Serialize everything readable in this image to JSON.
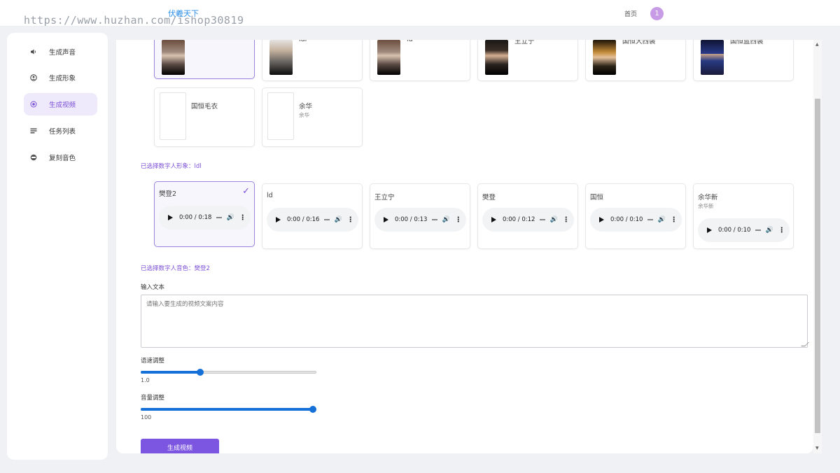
{
  "header": {
    "watermark": "https://www.huzhan.com/ishop30819",
    "brand": "伏羲天下",
    "home_link": "首页",
    "avatar_initial": "1"
  },
  "sidebar": {
    "items": [
      {
        "label": "生成声音",
        "icon": "speaker-icon",
        "active": false
      },
      {
        "label": "生成形象",
        "icon": "user-icon",
        "active": false
      },
      {
        "label": "生成视频",
        "icon": "target-icon",
        "active": true
      },
      {
        "label": "任务列表",
        "icon": "list-icon",
        "active": false
      },
      {
        "label": "复刻音色",
        "icon": "palette-icon",
        "active": false
      }
    ]
  },
  "avatars": {
    "row1": [
      {
        "name": "",
        "sub": "",
        "photo": "photo-a",
        "selected": true
      },
      {
        "name": "ldl",
        "sub": "",
        "photo": "photo-b",
        "selected": false
      },
      {
        "name": "ld",
        "sub": "",
        "photo": "photo-a",
        "selected": false
      },
      {
        "name": "王立宁",
        "sub": "",
        "photo": "photo-c",
        "selected": false
      },
      {
        "name": "国恒大西装",
        "sub": "",
        "photo": "photo-d",
        "selected": false
      },
      {
        "name": "国恒蓝西装",
        "sub": "",
        "photo": "photo-e",
        "selected": false
      }
    ],
    "row2": [
      {
        "name": "国恒毛衣",
        "sub": ""
      },
      {
        "name": "余华",
        "sub": "余华"
      }
    ],
    "selected_text": "已选择数字人形象：ldl"
  },
  "voices": {
    "items": [
      {
        "name": "樊登2",
        "sub": "",
        "time": "0:00 / 0:18",
        "selected": true
      },
      {
        "name": "ld",
        "sub": "",
        "time": "0:00 / 0:16",
        "selected": false
      },
      {
        "name": "王立宁",
        "sub": "",
        "time": "0:00 / 0:13",
        "selected": false
      },
      {
        "name": "樊登",
        "sub": "",
        "time": "0:00 / 0:12",
        "selected": false
      },
      {
        "name": "国恒",
        "sub": "",
        "time": "0:00 / 0:10",
        "selected": false
      },
      {
        "name": "余华新",
        "sub": "余华新",
        "time": "0:00 / 0:10",
        "selected": false
      }
    ],
    "selected_text": "已选择数字人音色：樊登2"
  },
  "form": {
    "text_label": "输入文本",
    "text_placeholder": "请输入要生成的视频文案内容",
    "speed_label": "语速调整",
    "speed_value": "1.0",
    "speed_fraction": 0.34,
    "volume_label": "音量调整",
    "volume_value": "100",
    "volume_fraction": 0.98,
    "submit_label": "生成视频"
  },
  "colors": {
    "accent": "#7c56e0",
    "link": "#2e8fe8",
    "slider": "#1570d8"
  }
}
